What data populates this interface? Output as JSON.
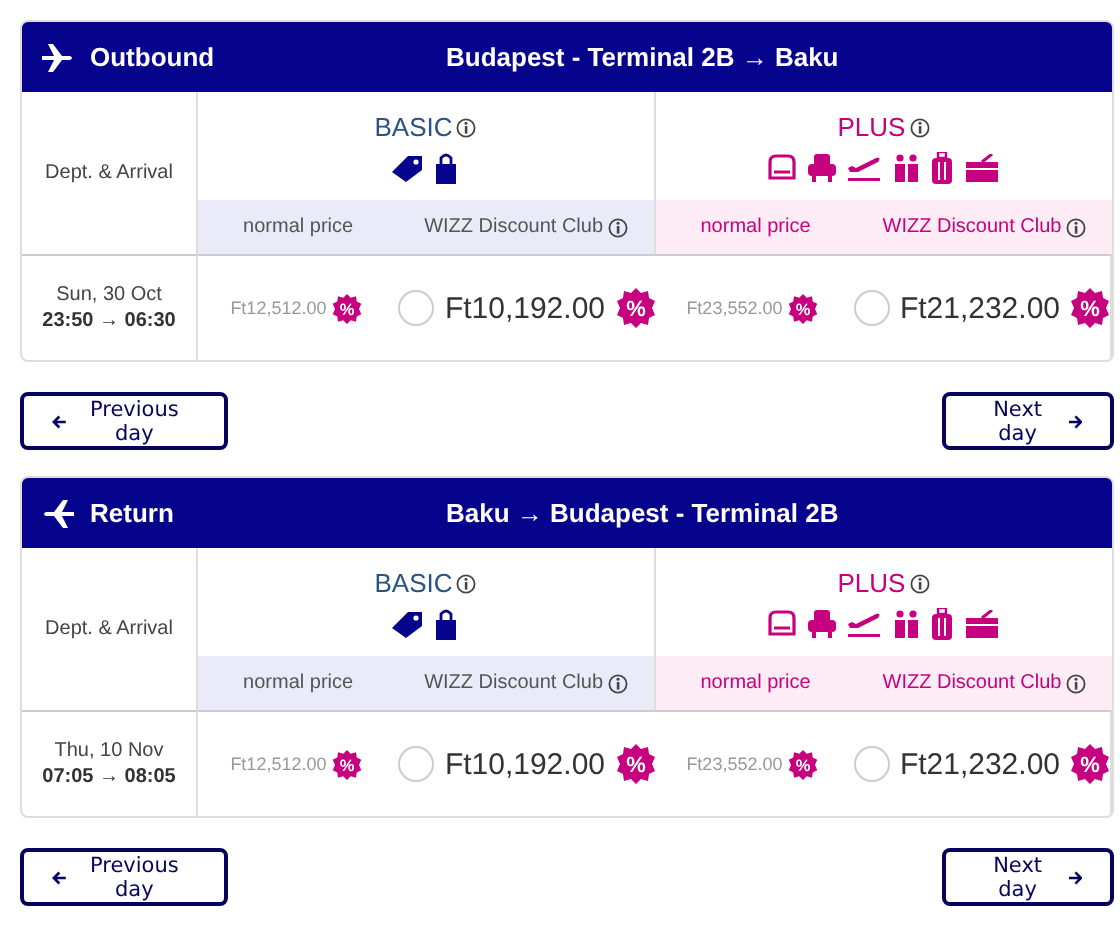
{
  "flights": [
    {
      "kind": "outbound",
      "label": "Outbound",
      "route": "Budapest - Terminal 2B → Baku",
      "time_heading": "Dept. & Arrival",
      "date": "Sun, 30 Oct",
      "times": "23:50 → 06:30",
      "fares": [
        {
          "kind": "basic",
          "name": "BASIC",
          "normal_label": "normal price",
          "club_label": "WIZZ Discount Club",
          "normal_price": "Ft12,512.00",
          "normal_badge": "%",
          "club_price": "Ft10,192.00",
          "club_badge": "%",
          "selected": false
        },
        {
          "kind": "plus",
          "name": "PLUS",
          "normal_label": "normal price",
          "club_label": "WIZZ Discount Club",
          "normal_price": "Ft23,552.00",
          "normal_badge": "%",
          "club_price": "Ft21,232.00",
          "club_badge": "%",
          "selected": false
        }
      ],
      "prev_button": "Previous day",
      "next_button": "Next day"
    },
    {
      "kind": "return",
      "label": "Return",
      "route": "Baku → Budapest - Terminal 2B",
      "time_heading": "Dept. & Arrival",
      "date": "Thu, 10 Nov",
      "times": "07:05 → 08:05",
      "fares": [
        {
          "kind": "basic",
          "name": "BASIC",
          "normal_label": "normal price",
          "club_label": "WIZZ Discount Club",
          "normal_price": "Ft12,512.00",
          "normal_badge": "%",
          "club_price": "Ft10,192.00",
          "club_badge": "%",
          "selected": false
        },
        {
          "kind": "plus",
          "name": "PLUS",
          "normal_label": "normal price",
          "club_label": "WIZZ Discount Club",
          "normal_price": "Ft23,552.00",
          "normal_badge": "%",
          "club_price": "Ft21,232.00",
          "club_badge": "%",
          "selected": false
        }
      ],
      "prev_button": "Previous day",
      "next_button": "Next day"
    }
  ]
}
